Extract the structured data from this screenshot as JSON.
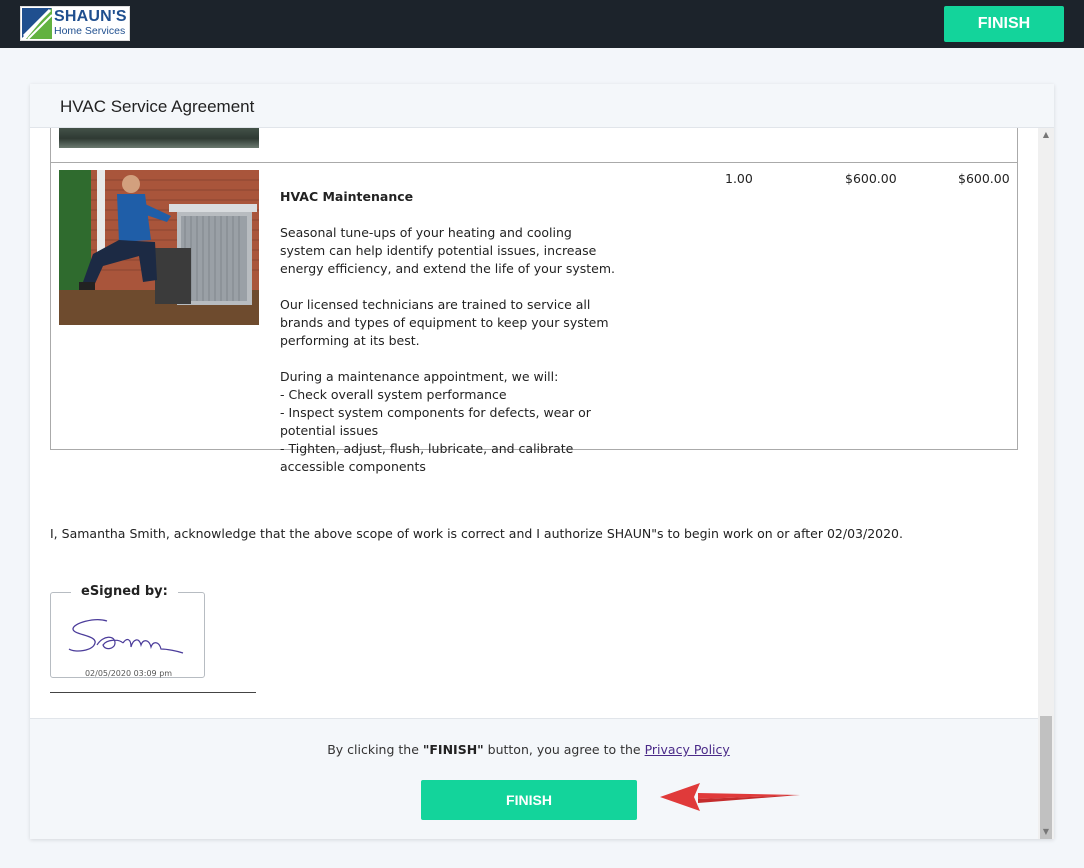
{
  "header": {
    "logo_brand": "SHAUN'S",
    "logo_sub": "Home Services",
    "finish_label": "FINISH"
  },
  "card": {
    "title": "HVAC Service Agreement"
  },
  "item": {
    "name": "HVAC Maintenance",
    "description": "Seasonal tune-ups of your heating and cooling\nsystem can help identify potential issues, increase\nenergy efficiency, and extend the life of your system.\n\nOur licensed technicians are trained to service all\nbrands and types of equipment to keep your system\nperforming at its best.\n\nDuring a maintenance appointment, we will:\n- Check overall system performance\n- Inspect system components for defects, wear or\npotential issues\n- Tighten, adjust, flush, lubricate, and calibrate\naccessible components",
    "quantity": "1.00",
    "unit_price": "$600.00",
    "total": "$600.00"
  },
  "acknowledgement": "I, Samantha Smith, acknowledge that the above scope of work is correct and I authorize SHAUN\"s to begin work on or after 02/03/2020.",
  "signature": {
    "label": "eSigned by:",
    "timestamp": "02/05/2020 03:09 pm"
  },
  "footer": {
    "agree_prefix": "By clicking the ",
    "agree_button_ref": "\"FINISH\"",
    "agree_middle": " button, you agree to the ",
    "privacy_link": "Privacy Policy",
    "finish_label": "FINISH"
  },
  "colors": {
    "accent": "#13d49b",
    "topbar": "#1c232b",
    "annotation_arrow": "#e03a3a"
  }
}
